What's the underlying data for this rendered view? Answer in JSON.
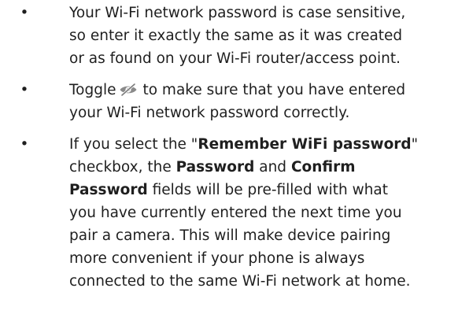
{
  "bullets": [
    {
      "lines": [
        "Your Wi-Fi network password is case sensitive,",
        "so enter it exactly the same as it was created",
        "or as found on your Wi-Fi router/access point."
      ]
    },
    {
      "line1_before_icon": "Toggle",
      "icon": "eye-hide-icon",
      "line1_after_icon": "to make sure that you have entered",
      "line2": "your Wi-Fi network password correctly."
    },
    {
      "line1_a": "If you select the \"",
      "line1_bold": "Remember WiFi password",
      "line1_b": "\"",
      "line2_a": "checkbox, the ",
      "line2_bold1": "Password",
      "line2_mid": " and ",
      "line2_bold2": "Confirm",
      "line3_bold": "Password",
      "line3_rest": " fields will be pre-filled with what",
      "line4": "you have currently entered the next time you",
      "line5": "pair a camera. This will make device pairing",
      "line6": "more convenient if your phone is always",
      "line7": "connected to the same Wi-Fi network at home."
    }
  ],
  "bullet_symbol": "•"
}
